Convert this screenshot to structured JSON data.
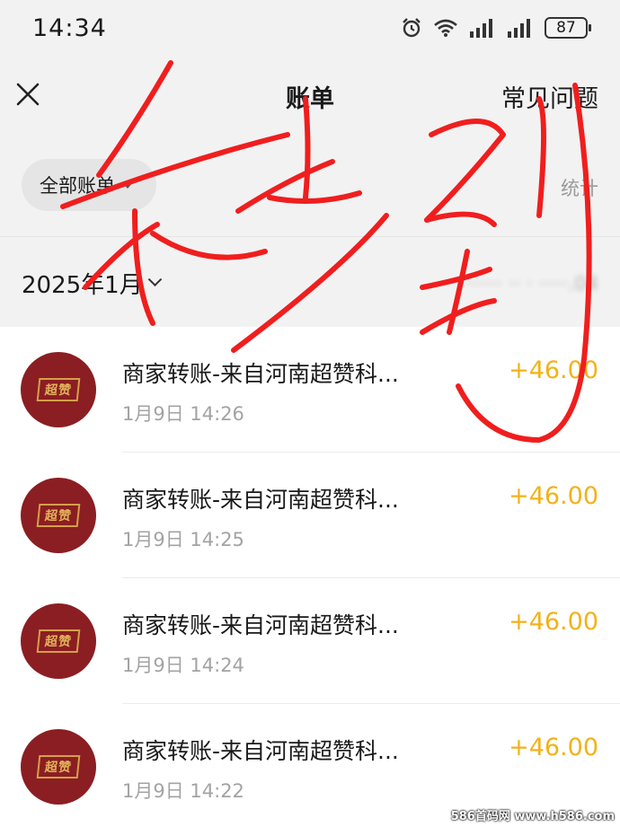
{
  "status_bar": {
    "time": "14:34",
    "battery": "87"
  },
  "nav": {
    "title": "账单",
    "faq": "常见问题"
  },
  "filter": {
    "label": "全部账单",
    "stats": "统计"
  },
  "month": {
    "label": "2025年1月",
    "summary": "······ ·· · ·····.04"
  },
  "rows": [
    {
      "title": "商家转账-来自河南超赞科...",
      "time": "1月9日 14:26",
      "amount": "+46.00"
    },
    {
      "title": "商家转账-来自河南超赞科...",
      "time": "1月9日 14:25",
      "amount": "+46.00"
    },
    {
      "title": "商家转账-来自河南超赞科...",
      "time": "1月9日 14:24",
      "amount": "+46.00"
    },
    {
      "title": "商家转账-来自河南超赞科...",
      "time": "1月9日 14:22",
      "amount": "+46.00"
    }
  ],
  "avatar_mark": "超赞",
  "watermark": "586首码网 www.h586.com",
  "colors": {
    "amount": "#f2b21a",
    "avatar_bg": "#8b1e22",
    "scribble": "#f01e1e"
  }
}
